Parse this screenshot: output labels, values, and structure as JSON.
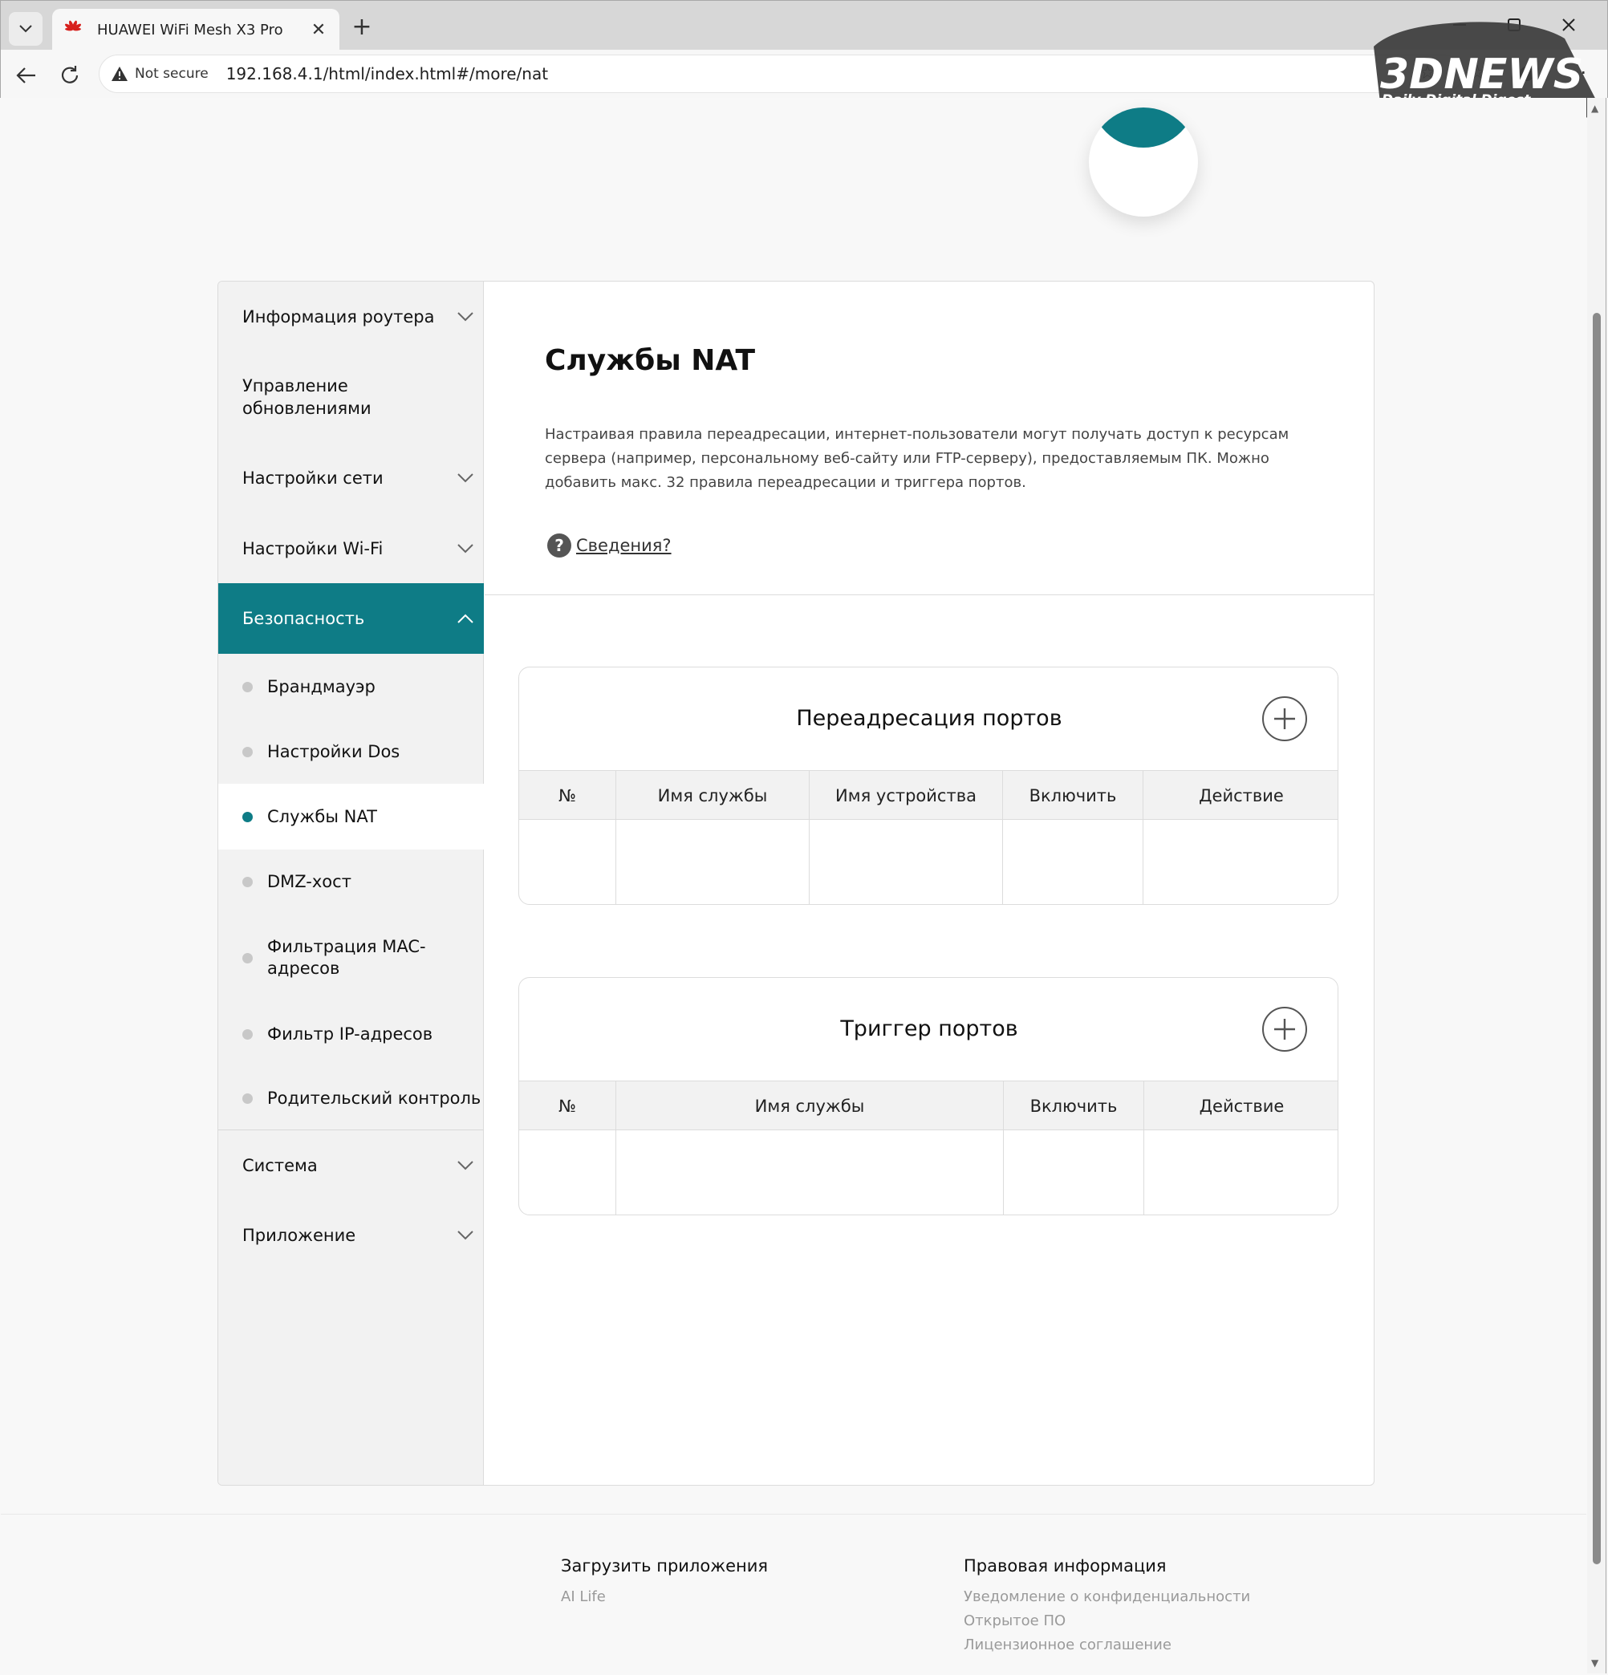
{
  "browser": {
    "tab_title": "HUAWEI WiFi Mesh X3 Pro",
    "security_label": "Not secure",
    "url": "192.168.4.1/html/index.html#/more/nat"
  },
  "watermark": {
    "brand": "3DNEWS",
    "tagline": "Daily Digital Digest"
  },
  "sidebar": {
    "items": [
      {
        "label": "Информация роутера",
        "expandable": true
      },
      {
        "label": "Управление обновлениями",
        "expandable": false
      },
      {
        "label": "Настройки сети",
        "expandable": true
      },
      {
        "label": "Настройки Wi-Fi",
        "expandable": true
      },
      {
        "label": "Безопасность",
        "expandable": true,
        "active": true
      },
      {
        "label": "Система",
        "expandable": true
      },
      {
        "label": "Приложение",
        "expandable": true
      }
    ],
    "security_subitems": [
      "Брандмауэр",
      "Настройки Dos",
      "Службы NAT",
      "DMZ-хост",
      "Фильтрация MAC-адресов",
      "Фильтр IP-адресов",
      "Родительский контроль"
    ],
    "selected_subitem": "Службы NAT"
  },
  "main": {
    "title": "Службы NAT",
    "description": "Настраивая правила переадресации, интернет-пользователи могут получать доступ к ресурсам сервера (например, персональному веб-сайту или FTP-серверу), предоставляемым ПК. Можно добавить макс. 32 правила переадресации и триггера портов.",
    "help_link": "Сведения?",
    "port_forwarding": {
      "title": "Переадресация портов",
      "columns": [
        "№",
        "Имя службы",
        "Имя устройства",
        "Включить",
        "Действие"
      ]
    },
    "port_trigger": {
      "title": "Триггер портов",
      "columns": [
        "№",
        "Имя службы",
        "Включить",
        "Действие"
      ]
    }
  },
  "footer": {
    "apps_heading": "Загрузить приложения",
    "apps_link": "AI Life",
    "legal_heading": "Правовая информация",
    "legal_links": [
      "Уведомление о конфиденциальности",
      "Открытое ПО",
      "Лицензионное соглашение"
    ]
  },
  "colors": {
    "accent": "#0e7c86",
    "sidebar_bg": "#f2f2f2",
    "inactive_dot": "#c8c8c8"
  }
}
